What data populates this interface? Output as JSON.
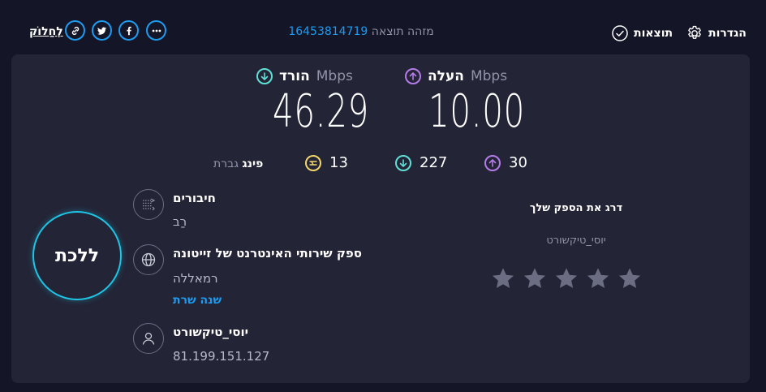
{
  "header": {
    "share_label": "לְחַלוֹק",
    "result_id_label": "מזהה תוצאה",
    "result_id": "16453814719",
    "results_label": "תוצאות",
    "settings_label": "הגדרות"
  },
  "speeds": {
    "download": {
      "unit": "Mbps",
      "label": "הורד",
      "value": "46.29"
    },
    "upload": {
      "unit": "Mbps",
      "label": "העלה",
      "value": "10.00"
    }
  },
  "ping": {
    "label": "פינג",
    "unit": "גברת",
    "idle": "13",
    "download": "227",
    "upload": "30"
  },
  "go_button": "ללכת",
  "connections": {
    "title": "חיבורים",
    "value": "רַב"
  },
  "isp": {
    "title": "ספק שירותי האינטרנט של זייטונה",
    "location": "רמאללה",
    "change_link": "שנה שרת"
  },
  "host": {
    "title": "יוסי_טיקשורט",
    "ip": "81.199.151.127"
  },
  "rating": {
    "title": "דרג את הספק שלך",
    "provider": "יוסי_טיקשורט",
    "stars": 5
  },
  "colors": {
    "accent": "#1d9bf0",
    "download": "#5fe0d6",
    "upload": "#b57be8",
    "ping": "#f3d76b",
    "go_ring": "#1ec5e5"
  }
}
